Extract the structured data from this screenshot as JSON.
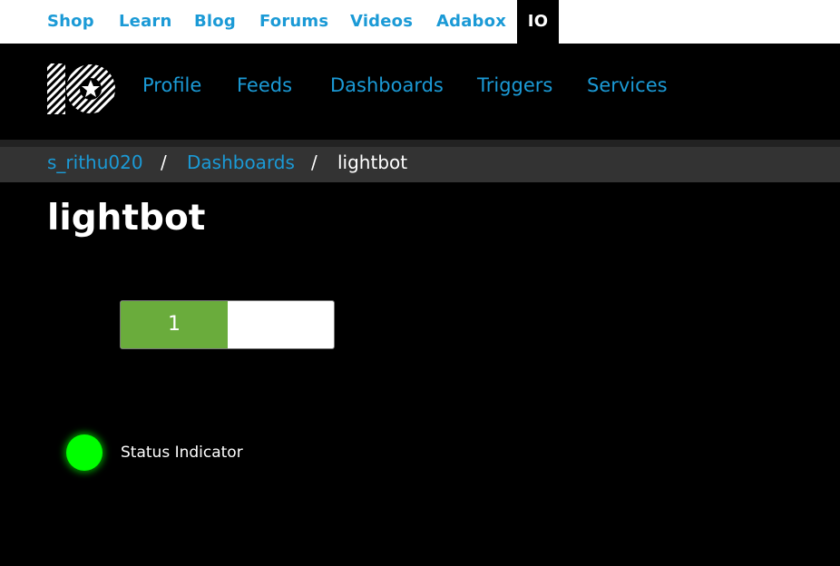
{
  "topnav": {
    "items": [
      {
        "label": "Shop"
      },
      {
        "label": "Learn"
      },
      {
        "label": "Blog"
      },
      {
        "label": "Forums"
      },
      {
        "label": "Videos"
      },
      {
        "label": "Adabox"
      },
      {
        "label": "IO"
      }
    ],
    "active": "IO"
  },
  "logo": {
    "icon": "adafruit-io-logo",
    "text": "IO"
  },
  "mainnav": {
    "items": [
      {
        "label": "Profile"
      },
      {
        "label": "Feeds"
      },
      {
        "label": "Dashboards"
      },
      {
        "label": "Triggers"
      },
      {
        "label": "Services"
      }
    ]
  },
  "breadcrumb": {
    "user": "s_rithu020",
    "separator": "/",
    "section": "Dashboards",
    "current": "lightbot"
  },
  "page": {
    "title": "lightbot"
  },
  "toggle": {
    "value": "1",
    "state": "on",
    "on_color": "#6aac3c"
  },
  "indicator": {
    "label": "Status Indicator",
    "color": "#00ff00"
  },
  "colors": {
    "link": "#1b9ad6",
    "background": "#000000"
  }
}
